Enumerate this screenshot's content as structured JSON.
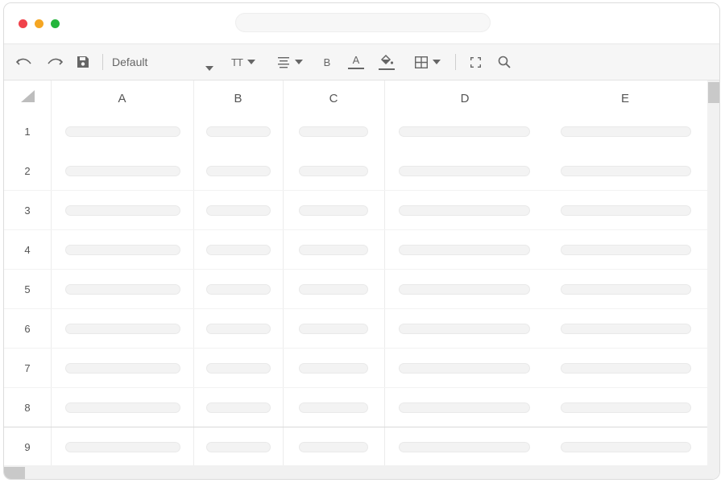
{
  "toolbar": {
    "icons": [
      "undo-icon",
      "redo-icon",
      "save-icon",
      "font-size-icon",
      "align-icon",
      "bold-icon",
      "font-color-icon",
      "fill-color-icon",
      "borders-icon",
      "fullscreen-icon",
      "search-icon"
    ],
    "font_select": "Default",
    "font_size_label": "TT",
    "bold_label": "B",
    "font_color_label": "A"
  },
  "sheet": {
    "columns": [
      "A",
      "B",
      "C",
      "D",
      "E"
    ],
    "rows": [
      "1",
      "2",
      "3",
      "4",
      "5",
      "6",
      "7",
      "8",
      "9"
    ]
  },
  "colors": {
    "close": "#f0424b",
    "minimize": "#f5a623",
    "maximize": "#24b53c"
  }
}
